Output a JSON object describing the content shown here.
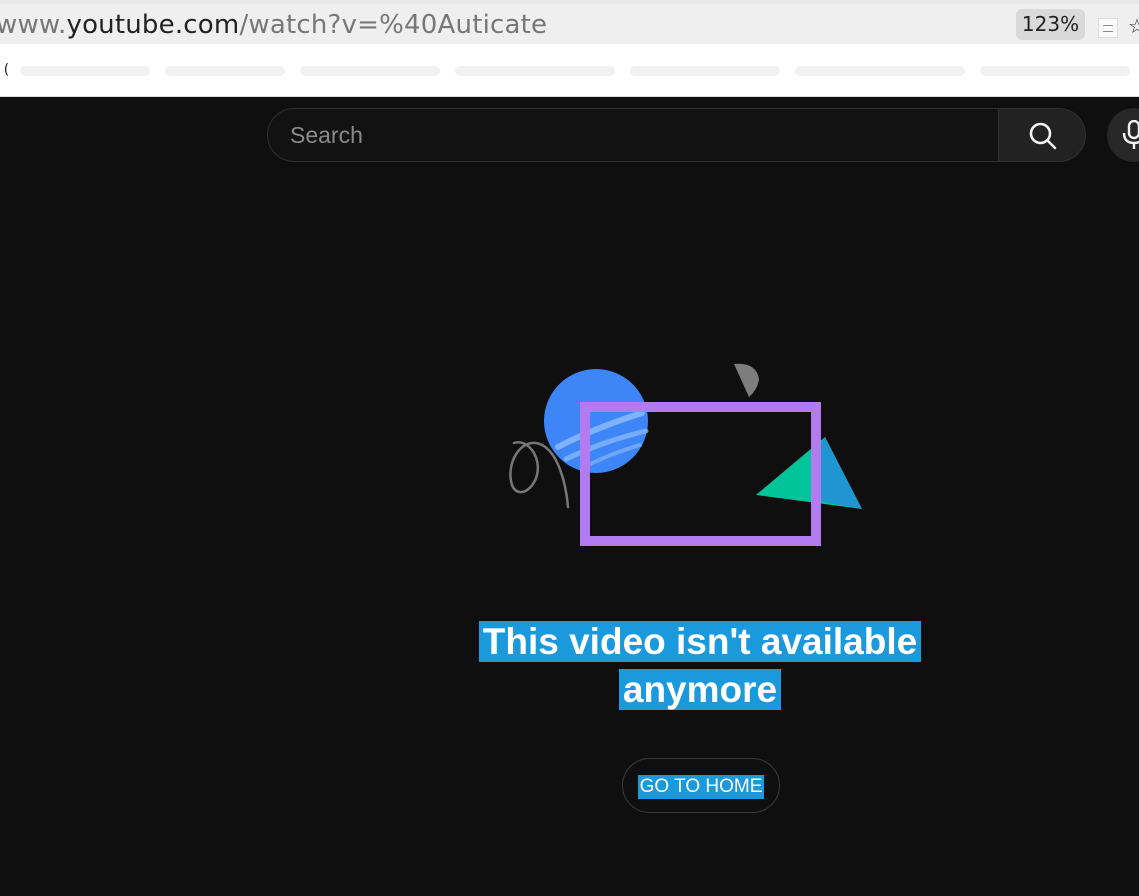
{
  "browser": {
    "url_prefix": "www.",
    "url_host": "youtube.com",
    "url_path": "/watch?v=%40Auticate",
    "zoom_level": "123%",
    "bookmark_glyph": "(",
    "icons": [
      "extension-icon",
      "star-icon"
    ]
  },
  "header": {
    "search_placeholder": "Search",
    "icons": [
      "search-icon",
      "mic-icon"
    ]
  },
  "error": {
    "line1": "This video isn't available",
    "line2": "anymore",
    "home_button_label": "GO TO HOME"
  },
  "colors": {
    "background": "#0f0f0f",
    "selection_highlight": "#1a9adc",
    "illustration_purple": "#b27cf0",
    "illustration_blue": "#3e85f7",
    "illustration_teal": "#00c49a"
  }
}
